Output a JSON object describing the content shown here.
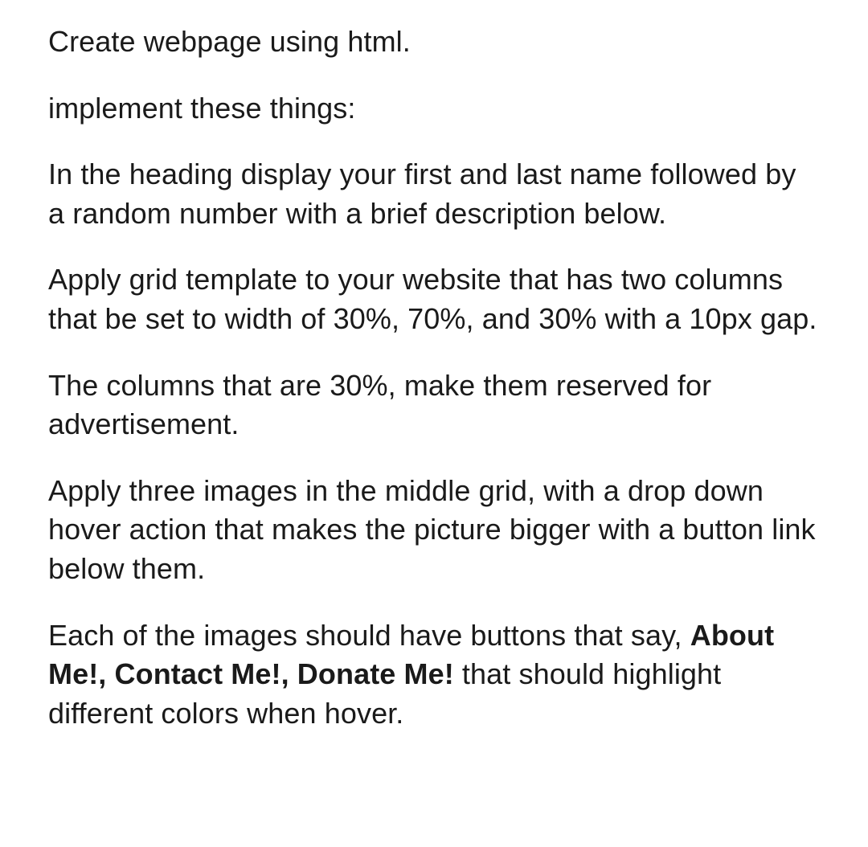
{
  "paragraphs": {
    "p1": "Create webpage using html.",
    "p2": "implement these things:",
    "p3": "In the heading display your first and last name followed by a random number with a brief description below.",
    "p4": "Apply grid template to your website that has two columns that be set to width of 30%, 70%, and 30% with a 10px gap.",
    "p5": "The columns that are 30%, make them reserved for advertisement.",
    "p6": "Apply three images in the middle grid, with a drop down hover action that makes the picture bigger with a button link below them.",
    "p7_a": "Each of the images should have buttons that say, ",
    "p7_b": "About Me!, Contact Me!, Donate Me!",
    "p7_c": " that should highlight different colors when hover."
  }
}
